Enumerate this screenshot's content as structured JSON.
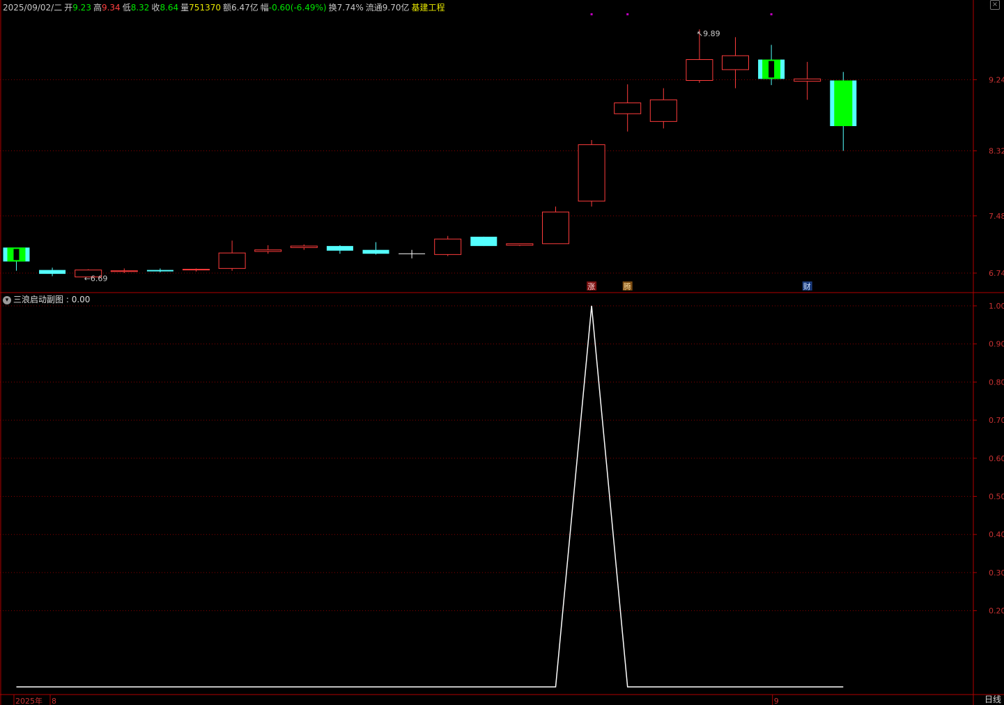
{
  "info_bar": {
    "date": "2025/09/02/二",
    "open_label": "开",
    "open": "9.23",
    "high_label": "高",
    "high": "9.34",
    "low_label": "低",
    "low": "8.32",
    "close_label": "收",
    "close": "8.64",
    "volume_label": "量",
    "volume": "751370",
    "amount_label": "额",
    "amount": "6.47亿",
    "change_label": "幅",
    "change": "-0.60(-6.49%)",
    "turnover_label": "换",
    "turnover": "7.74%",
    "float_label": "流通",
    "float_cap": "9.70亿",
    "sector": "基建工程"
  },
  "sub_title": {
    "name": "三浪启动副图",
    "value": "0.00"
  },
  "timeframe": "日线",
  "colors": {
    "up": "#ff3c3c",
    "down_cyan": "#54ffff",
    "down_green": "#00ff00",
    "grid": "#8a0000",
    "axis_text": "#c83232",
    "indicator": "#ffffff",
    "marker": "#c000c0",
    "flat": "#ffffff"
  },
  "chart_data": [
    {
      "type": "candlestick",
      "title": "",
      "candles": [
        {
          "o": 6.89,
          "h": 7.0,
          "l": 6.77,
          "c": 7.07,
          "style": "down_green_cyan"
        },
        {
          "o": 6.78,
          "h": 6.81,
          "l": 6.7,
          "c": 6.73,
          "style": "down_cyan"
        },
        {
          "o": 6.69,
          "h": 6.79,
          "l": 6.69,
          "c": 6.78,
          "style": "up"
        },
        {
          "o": 6.76,
          "h": 6.8,
          "l": 6.74,
          "c": 6.77,
          "style": "up"
        },
        {
          "o": 6.78,
          "h": 6.8,
          "l": 6.75,
          "c": 6.77,
          "style": "down_cyan"
        },
        {
          "o": 6.78,
          "h": 6.8,
          "l": 6.76,
          "c": 6.79,
          "style": "up"
        },
        {
          "o": 6.8,
          "h": 7.16,
          "l": 6.77,
          "c": 7.0,
          "style": "up"
        },
        {
          "o": 7.02,
          "h": 7.1,
          "l": 6.99,
          "c": 7.04,
          "style": "up"
        },
        {
          "o": 7.07,
          "h": 7.11,
          "l": 7.04,
          "c": 7.09,
          "style": "up"
        },
        {
          "o": 7.09,
          "h": 7.1,
          "l": 6.99,
          "c": 7.03,
          "style": "down_cyan"
        },
        {
          "o": 7.04,
          "h": 7.14,
          "l": 6.98,
          "c": 6.99,
          "style": "down_cyan"
        },
        {
          "o": 6.99,
          "h": 7.04,
          "l": 6.93,
          "c": 6.99,
          "style": "flat"
        },
        {
          "o": 6.98,
          "h": 7.22,
          "l": 6.96,
          "c": 7.18,
          "style": "up"
        },
        {
          "o": 7.21,
          "h": 7.21,
          "l": 7.09,
          "c": 7.09,
          "style": "down_cyan"
        },
        {
          "o": 7.1,
          "h": 7.12,
          "l": 7.09,
          "c": 7.12,
          "style": "up"
        },
        {
          "o": 7.12,
          "h": 7.6,
          "l": 7.12,
          "c": 7.53,
          "style": "up"
        },
        {
          "o": 7.67,
          "h": 8.46,
          "l": 7.6,
          "c": 8.4,
          "style": "up"
        },
        {
          "o": 8.8,
          "h": 9.18,
          "l": 8.57,
          "c": 8.94,
          "style": "up"
        },
        {
          "o": 8.7,
          "h": 9.13,
          "l": 8.61,
          "c": 8.98,
          "style": "up"
        },
        {
          "o": 9.23,
          "h": 9.89,
          "l": 9.2,
          "c": 9.5,
          "style": "up"
        },
        {
          "o": 9.37,
          "h": 9.79,
          "l": 9.13,
          "c": 9.55,
          "style": "up"
        },
        {
          "o": 9.5,
          "h": 9.69,
          "l": 9.17,
          "c": 9.25,
          "style": "down_green_cyan"
        },
        {
          "o": 9.22,
          "h": 9.47,
          "l": 8.98,
          "c": 9.25,
          "style": "up"
        },
        {
          "o": 9.23,
          "h": 9.34,
          "l": 8.32,
          "c": 8.64,
          "style": "down_green_cyan"
        }
      ],
      "y_ticks": [
        9.24,
        8.32,
        7.48,
        6.74
      ],
      "ylim": [
        6.65,
        10.09
      ],
      "annotations": [
        {
          "index": 2,
          "text": "6.69",
          "kind": "low"
        },
        {
          "index": 19,
          "text": "9.89",
          "kind": "high"
        }
      ],
      "top_markers": [
        16,
        17,
        21
      ],
      "badges": [
        {
          "index": 16,
          "text": "涨",
          "bg": "#7a1010",
          "fg": "#ffdddd"
        },
        {
          "index": 17,
          "text": "腾",
          "bg": "#7a4a10",
          "fg": "#ffe0a0"
        },
        {
          "index": 22,
          "text": "财",
          "bg": "#1a3a7a",
          "fg": "#d0e4ff"
        }
      ]
    },
    {
      "type": "line",
      "title": "三浪启动副图",
      "series": [
        {
          "values": [
            0,
            0,
            0,
            0,
            0,
            0,
            0,
            0,
            0,
            0,
            0,
            0,
            0,
            0,
            0,
            0,
            1,
            0,
            0,
            0,
            0,
            0,
            0,
            0
          ]
        }
      ],
      "y_ticks": [
        "1.00",
        "0.90",
        "0.80",
        "0.70",
        "0.60",
        "0.50",
        "0.40",
        "0.30",
        "0.20"
      ],
      "ylim": [
        0,
        1
      ],
      "x_labels": [
        {
          "text": "2025年",
          "index": 0
        },
        {
          "text": "8",
          "index": 1
        },
        {
          "text": "9",
          "index": 22
        }
      ]
    }
  ]
}
